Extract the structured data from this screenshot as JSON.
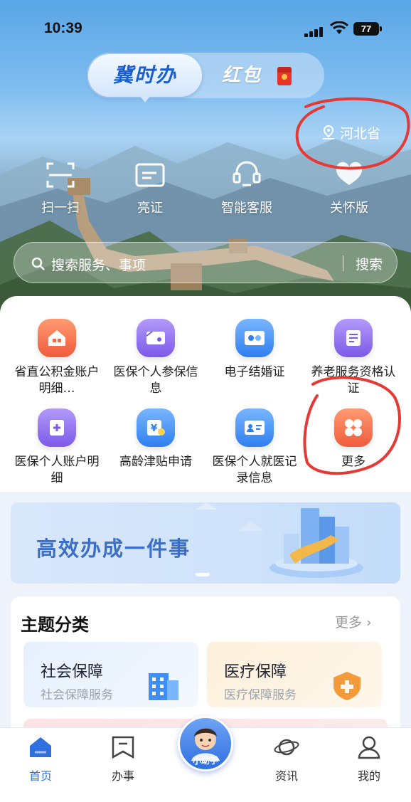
{
  "status_bar": {
    "time": "10:39",
    "battery": "77"
  },
  "header": {
    "brand_active": "冀时办",
    "brand_other": "红包",
    "location": "河北省"
  },
  "quick_actions": [
    {
      "label": "扫一扫",
      "icon": "scan-icon"
    },
    {
      "label": "亮证",
      "icon": "id-card-icon"
    },
    {
      "label": "智能客服",
      "icon": "headset-icon"
    },
    {
      "label": "关怀版",
      "icon": "care-icon"
    }
  ],
  "search": {
    "placeholder": "搜索服务、事项",
    "button": "搜索"
  },
  "services": [
    {
      "label": "省直公积金账户明细…",
      "icon": "house-icon",
      "color": "#f36b4a"
    },
    {
      "label": "医保个人参保信息",
      "icon": "insurance-card-icon",
      "color": "#8b6cf0"
    },
    {
      "label": "电子结婚证",
      "icon": "marriage-cert-icon",
      "color": "#3d8ef5"
    },
    {
      "label": "养老服务资格认证",
      "icon": "pension-icon",
      "color": "#8b6cf0"
    },
    {
      "label": "医保个人账户明细",
      "icon": "medical-account-icon",
      "color": "#8b6cf0"
    },
    {
      "label": "高龄津贴申请",
      "icon": "allowance-icon",
      "color": "#3d8ef5"
    },
    {
      "label": "医保个人就医记录信息",
      "icon": "medical-record-icon",
      "color": "#3d8ef5"
    },
    {
      "label": "更多",
      "icon": "more-grid-icon",
      "color": "#f36b4a"
    }
  ],
  "banner": {
    "text": "高效办成一件事"
  },
  "theme": {
    "title": "主题分类",
    "more": "更多 ›",
    "cards": [
      {
        "title": "社会保障",
        "subtitle": "社会保障服务"
      },
      {
        "title": "医疗保障",
        "subtitle": "医疗保障服务"
      }
    ]
  },
  "tabbar": {
    "tabs": [
      {
        "label": "首页",
        "icon": "home-icon",
        "active": true
      },
      {
        "label": "办事",
        "icon": "bookmark-icon",
        "active": false
      },
      {
        "label": "资讯",
        "icon": "planet-icon",
        "active": false
      },
      {
        "label": "我的",
        "icon": "user-icon",
        "active": false
      }
    ],
    "assistant": "小助手"
  },
  "colors": {
    "accent": "#2f6fe0",
    "annotation": "#e53935"
  }
}
